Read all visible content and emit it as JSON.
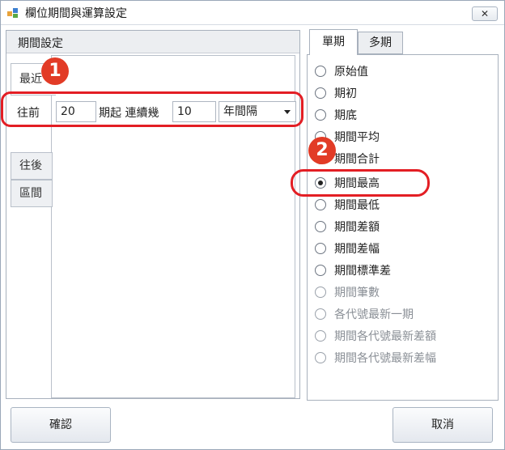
{
  "window": {
    "title": "欄位期間與運算設定",
    "close_label": "✕"
  },
  "left_panel": {
    "header": "期間設定",
    "side_tabs": [
      {
        "label": "最近"
      },
      {
        "label": "往前"
      },
      {
        "label": "往後"
      },
      {
        "label": "區間"
      }
    ],
    "row": {
      "label_before": "往前",
      "periods_value": "20",
      "label_mid": "期起 連續幾",
      "count_value": "10",
      "interval_selected": "年間隔"
    }
  },
  "right_panel": {
    "tabs": [
      {
        "label": "單期"
      },
      {
        "label": "多期"
      }
    ],
    "options": [
      {
        "label": "原始值",
        "checked": false,
        "disabled": false
      },
      {
        "label": "期初",
        "checked": false,
        "disabled": false
      },
      {
        "label": "期底",
        "checked": false,
        "disabled": false
      },
      {
        "label": "期間平均",
        "checked": false,
        "disabled": false
      },
      {
        "label": "期間合計",
        "checked": false,
        "disabled": false
      },
      {
        "label": "期間最高",
        "checked": true,
        "disabled": false
      },
      {
        "label": "期間最低",
        "checked": false,
        "disabled": false
      },
      {
        "label": "期間差額",
        "checked": false,
        "disabled": false
      },
      {
        "label": "期間差幅",
        "checked": false,
        "disabled": false
      },
      {
        "label": "期間標準差",
        "checked": false,
        "disabled": false
      },
      {
        "label": "期間筆數",
        "checked": false,
        "disabled": true
      },
      {
        "label": "各代號最新一期",
        "checked": false,
        "disabled": true
      },
      {
        "label": "期間各代號最新差額",
        "checked": false,
        "disabled": true
      },
      {
        "label": "期間各代號最新差幅",
        "checked": false,
        "disabled": true
      }
    ]
  },
  "buttons": {
    "confirm": "確認",
    "cancel": "取消"
  },
  "annotations": {
    "badge_1": "1",
    "badge_2": "2",
    "color": "#e31e24"
  }
}
